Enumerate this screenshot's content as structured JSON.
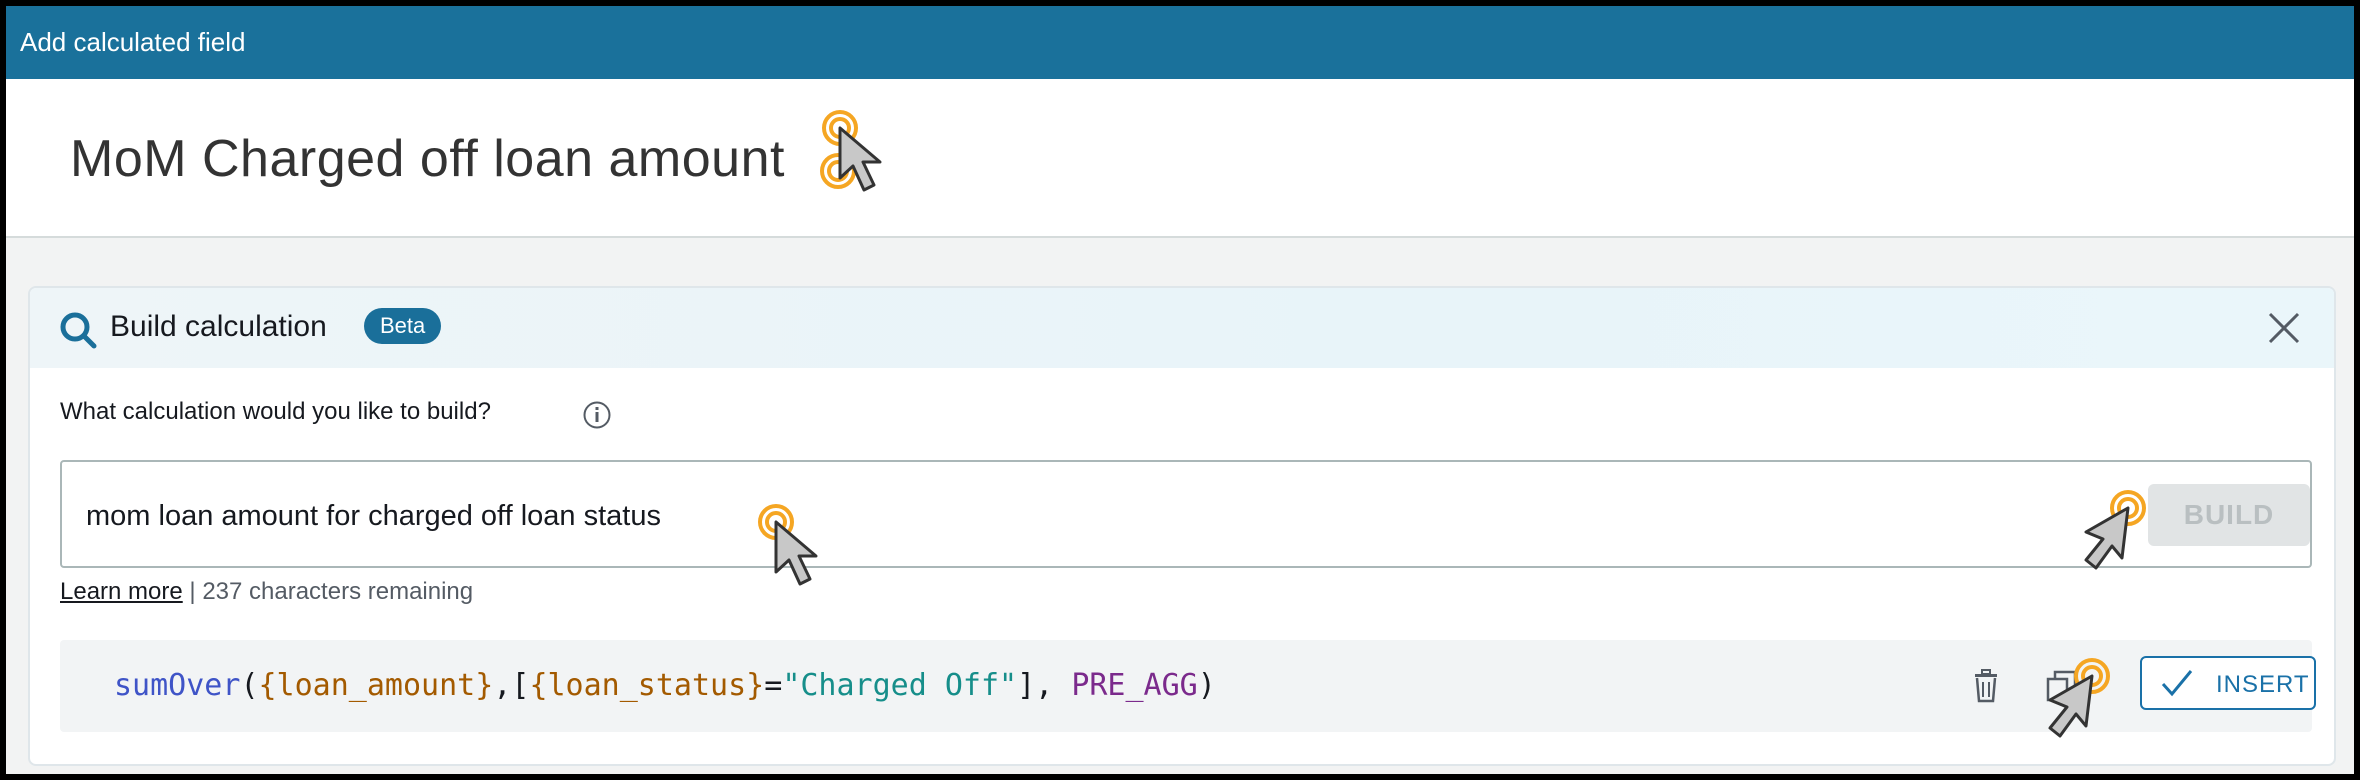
{
  "window": {
    "title": "Add calculated field"
  },
  "field": {
    "name": "MoM Charged off loan amount"
  },
  "build_panel": {
    "title": "Build calculation",
    "badge": "Beta",
    "question": "What calculation would you like to build?",
    "input_value": "mom loan amount for charged off loan status",
    "build_label": "BUILD",
    "learn_more": "Learn more",
    "separator": " | ",
    "chars_remaining": "237 characters remaining"
  },
  "formula": {
    "fn": "sumOver",
    "open": "(",
    "field1": "{loan_amount}",
    "comma1": ",[",
    "field2": "{loan_status}",
    "eq": "=",
    "string": "\"Charged Off\"",
    "close_bracket": "], ",
    "keyword": "PRE_AGG",
    "close": ")",
    "insert_label": "INSERT"
  },
  "colors": {
    "titlebar": "#1a719b",
    "badge": "#1a6f9a",
    "accent": "#1a71a8",
    "cursor_ring": "#f5a623"
  },
  "icons": [
    "edit-icon",
    "search-icon",
    "close-icon",
    "info-icon",
    "trash-icon",
    "copy-icon",
    "check-icon",
    "cursor-icon"
  ]
}
